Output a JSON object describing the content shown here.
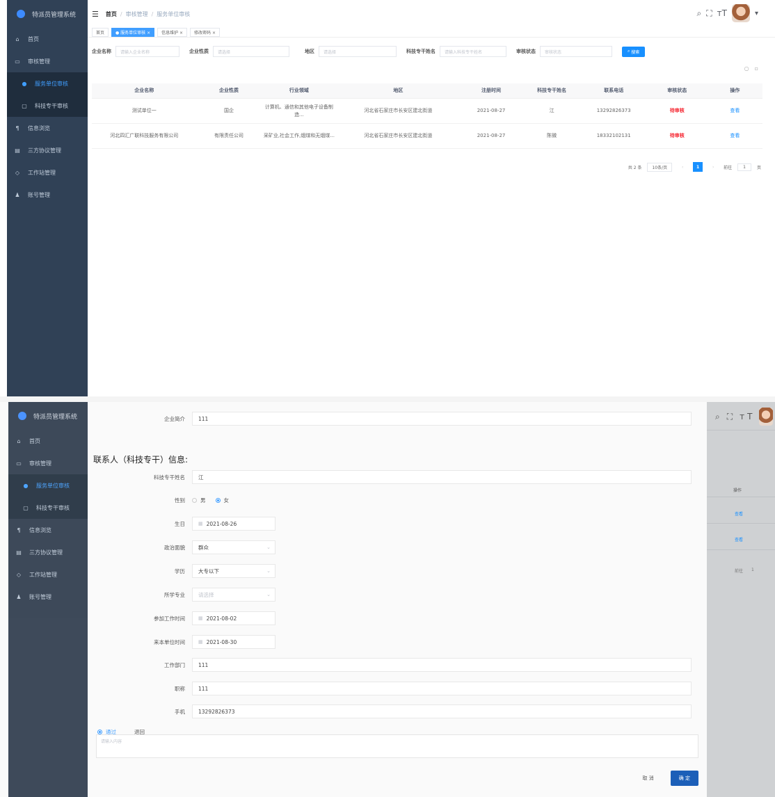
{
  "app": {
    "title": "特派员管理系统"
  },
  "sidebar": {
    "items": [
      {
        "label": "首页",
        "icon": "home-icon"
      },
      {
        "label": "审核管理",
        "icon": "audit-icon"
      },
      {
        "label": "服务单位审核",
        "icon": "org-icon"
      },
      {
        "label": "科技专干审核",
        "icon": "person-icon"
      },
      {
        "label": "信息浏览",
        "icon": "info-icon"
      },
      {
        "label": "三方协议管理",
        "icon": "doc-icon"
      },
      {
        "label": "工作站管理",
        "icon": "station-icon"
      },
      {
        "label": "账号管理",
        "icon": "user-icon"
      }
    ]
  },
  "navbar": {
    "breadcrumb": [
      "首页",
      "审核管理",
      "服务单位审核"
    ]
  },
  "tags": [
    {
      "label": "首页",
      "active": false
    },
    {
      "label": "● 服务单位审核 ×",
      "active": true
    },
    {
      "label": "信息维护 ×",
      "active": false
    },
    {
      "label": "修改密码 ×",
      "active": false
    }
  ],
  "search": {
    "company_label": "企业名称",
    "company_placeholder": "请输入企业名称",
    "nature_label": "企业性质",
    "nature_placeholder": "请选择",
    "area_label": "地区",
    "area_placeholder": "请选择",
    "cadre_label": "科技专干姓名",
    "cadre_placeholder": "请输入科技专干姓名",
    "status_label": "审核状态",
    "status_placeholder": "审核状态",
    "search_button": "搜索"
  },
  "table": {
    "headers": [
      "企业名称",
      "企业性质",
      "行业领域",
      "地区",
      "注册时间",
      "科技专干姓名",
      "联系电话",
      "审核状态",
      "操作"
    ],
    "rows": [
      {
        "name": "测试单位一",
        "nature": "国企",
        "industry": "计算机、通信和其他电子设备制造...",
        "area": "河北省石家庄市长安区建北街道",
        "reg_date": "2021-08-27",
        "cadre": "江",
        "phone": "13292826373",
        "status": "待审核",
        "op": "查看"
      },
      {
        "name": "河北四汇广联科技服务有限公司",
        "nature": "有限责任公司",
        "industry": "采矿业,社会工作,烟煤和无烟煤...",
        "area": "河北省石家庄市长安区建北街道",
        "reg_date": "2021-08-27",
        "cadre": "陈微",
        "phone": "18332102131",
        "status": "待审核",
        "op": "查看"
      }
    ]
  },
  "pagination": {
    "total": "共 2 条",
    "page_size": "10条/页",
    "current": "1",
    "goto_prefix": "前往",
    "goto_value": "1",
    "goto_suffix": "页"
  },
  "form": {
    "intro_label": "企业简介",
    "intro_value": "111",
    "section_title": "联系人（科技专干）信息:",
    "cadre_name_label": "科技专干姓名",
    "cadre_name_value": "江",
    "gender_label": "性别",
    "gender_male": "男",
    "gender_female": "女",
    "gender_selected": "女",
    "birthday_label": "生日",
    "birthday_value": "2021-08-26",
    "political_label": "政治面貌",
    "political_value": "群众",
    "education_label": "学历",
    "education_value": "大专以下",
    "major_label": "所学专业",
    "major_placeholder": "请选择",
    "work_start_label": "参加工作时间",
    "work_start_value": "2021-08-02",
    "join_label": "来本单位时间",
    "join_value": "2021-08-30",
    "dept_label": "工作部门",
    "dept_value": "111",
    "position_label": "职称",
    "position_value": "111",
    "phone_label": "手机",
    "phone_value": "13292826373",
    "audit_pass": "通过",
    "audit_reject": "退回",
    "remark_placeholder": "请输入内容",
    "cancel_button": "取 消",
    "ok_button": "确 定"
  },
  "overlay": {
    "op_header": "操作",
    "view1": "查看",
    "view2": "查看",
    "goto": "前往",
    "page": "1"
  },
  "colors": {
    "sidebar_bg": "#304156",
    "primary": "#1890ff",
    "pending": "#f5222d"
  }
}
